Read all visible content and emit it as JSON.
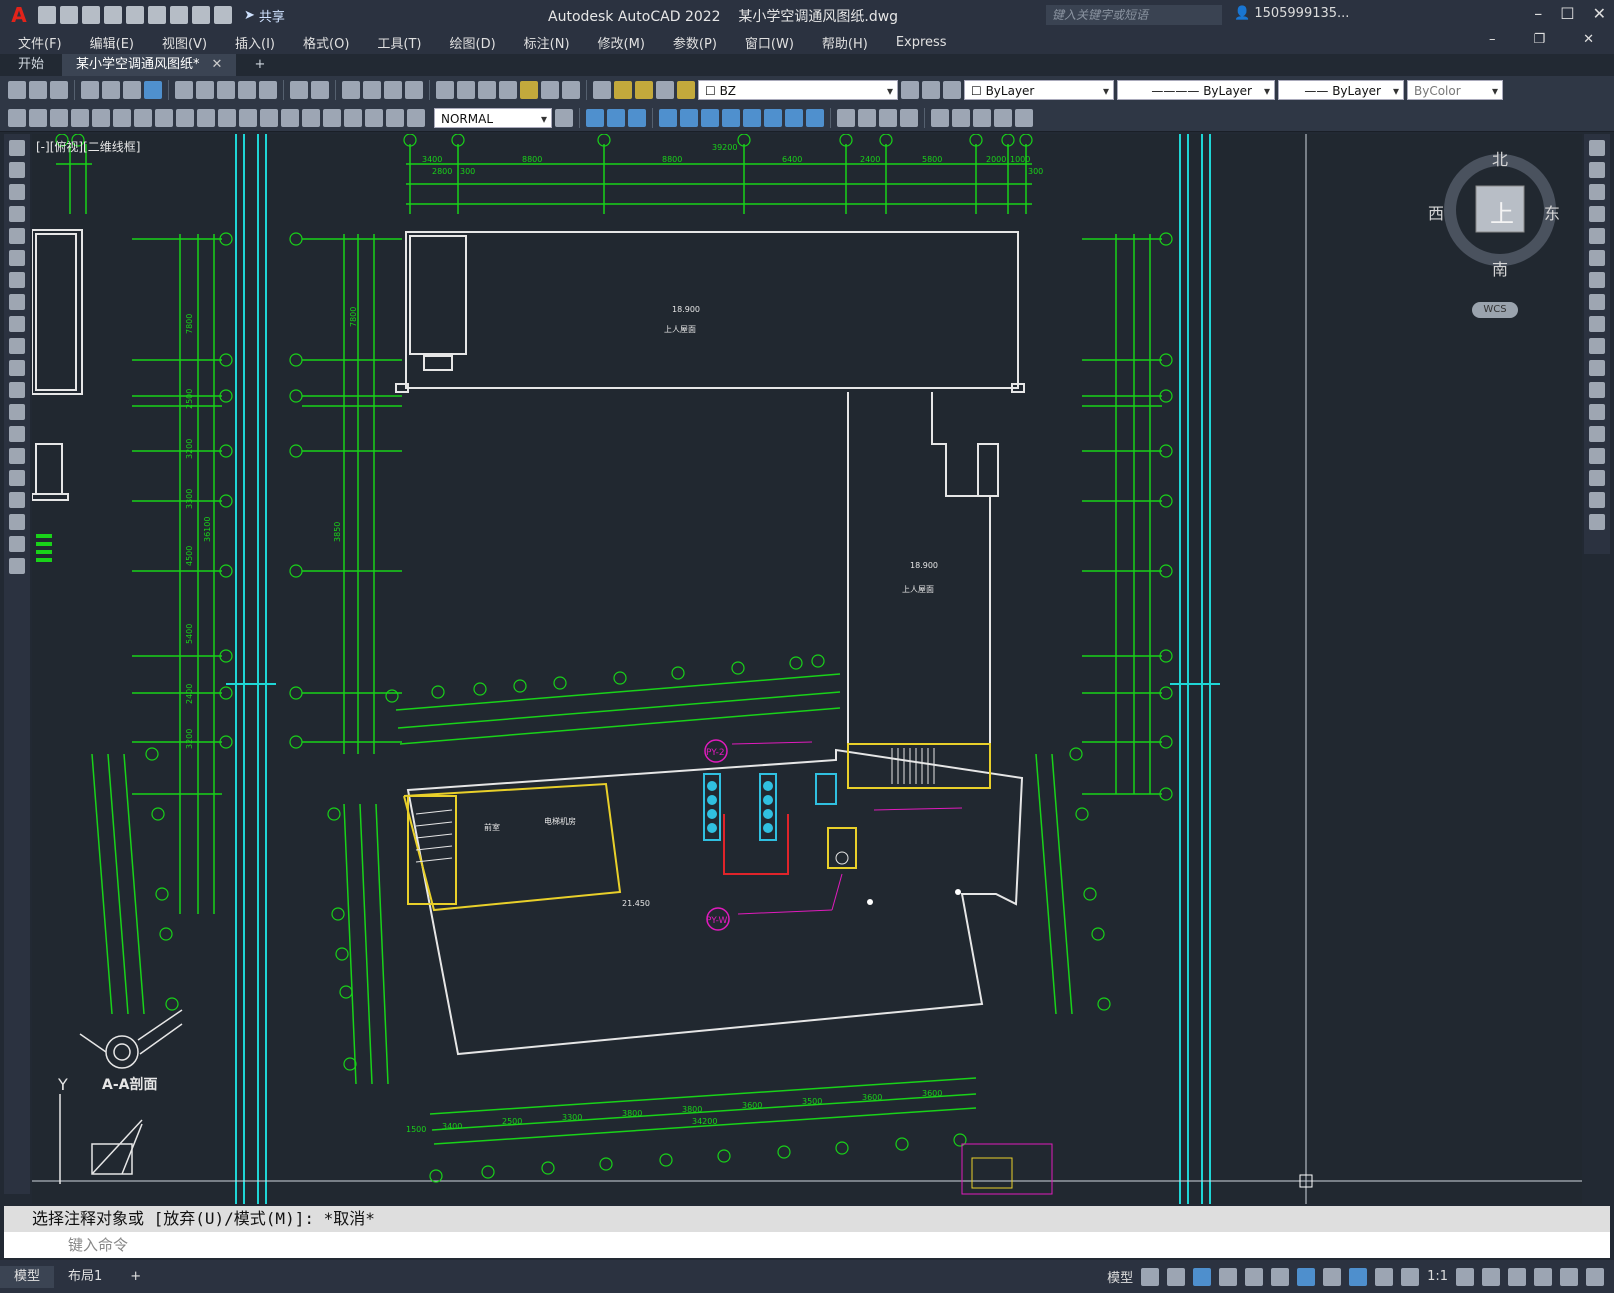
{
  "app": {
    "logo": "A",
    "title": "Autodesk AutoCAD 2022",
    "document": "某小学空调通风图纸.dwg",
    "share_label": "共享",
    "search_placeholder": "键入关键字或短语",
    "user": "1505999135..."
  },
  "menu": [
    "文件(F)",
    "编辑(E)",
    "视图(V)",
    "插入(I)",
    "格式(O)",
    "工具(T)",
    "绘图(D)",
    "标注(N)",
    "修改(M)",
    "参数(P)",
    "窗口(W)",
    "帮助(H)",
    "Express"
  ],
  "tabs": [
    {
      "label": "开始"
    },
    {
      "label": "某小学空调通风图纸*"
    },
    {
      "label": "+"
    }
  ],
  "toolbar": {
    "layer": "BZ",
    "color": "ByLayer",
    "linetype": "ByLayer",
    "lineweight": "ByLayer",
    "plotstyle": "ByColor",
    "textstyle": "NORMAL"
  },
  "viewport": {
    "label": "[-][俯视][二维线框]",
    "viewcube": {
      "north": "北",
      "south": "南",
      "east": "东",
      "west": "西",
      "top": "上",
      "wcs": "WCS"
    }
  },
  "drawing": {
    "section_title": "A-A剖面",
    "axis_y": "Y",
    "pipe_tags": [
      "PY-2",
      "PY-W"
    ],
    "room_labels": [
      "电梯机房",
      "前室",
      "上人屋面",
      "上人屋面"
    ],
    "levels": [
      "18.900",
      "18.900",
      "21.450"
    ],
    "top_dims": [
      "3400",
      "8800",
      "8800",
      "6400",
      "2400",
      "5800",
      "2000",
      "1000",
      "300",
      "2800",
      "300",
      "39200"
    ],
    "side_dims": [
      "7800",
      "2500",
      "3200",
      "3300",
      "4500",
      "5400",
      "2400",
      "3200",
      "36100",
      "7800",
      "3850"
    ],
    "lower_dims": [
      "3400",
      "2500",
      "3300",
      "3800",
      "3800",
      "3600",
      "3500",
      "3600",
      "3600",
      "34200",
      "1500"
    ]
  },
  "command": {
    "history": "选择注释对象或 [放弃(U)/模式(M)]: *取消*",
    "placeholder": "键入命令"
  },
  "status": {
    "tabs": [
      "模型",
      "布局1",
      "+"
    ],
    "model_label": "模型",
    "scale": "1:1"
  },
  "colors": {
    "dim_green": "#19d219",
    "grid_cyan": "#1fd6d6",
    "wall_white": "#e6e6e6",
    "duct_magenta": "#e01bbd",
    "yellow": "#e9d02a",
    "red": "#e0242a",
    "cyan_equip": "#30c0e0",
    "canvas_bg": "#212830"
  }
}
